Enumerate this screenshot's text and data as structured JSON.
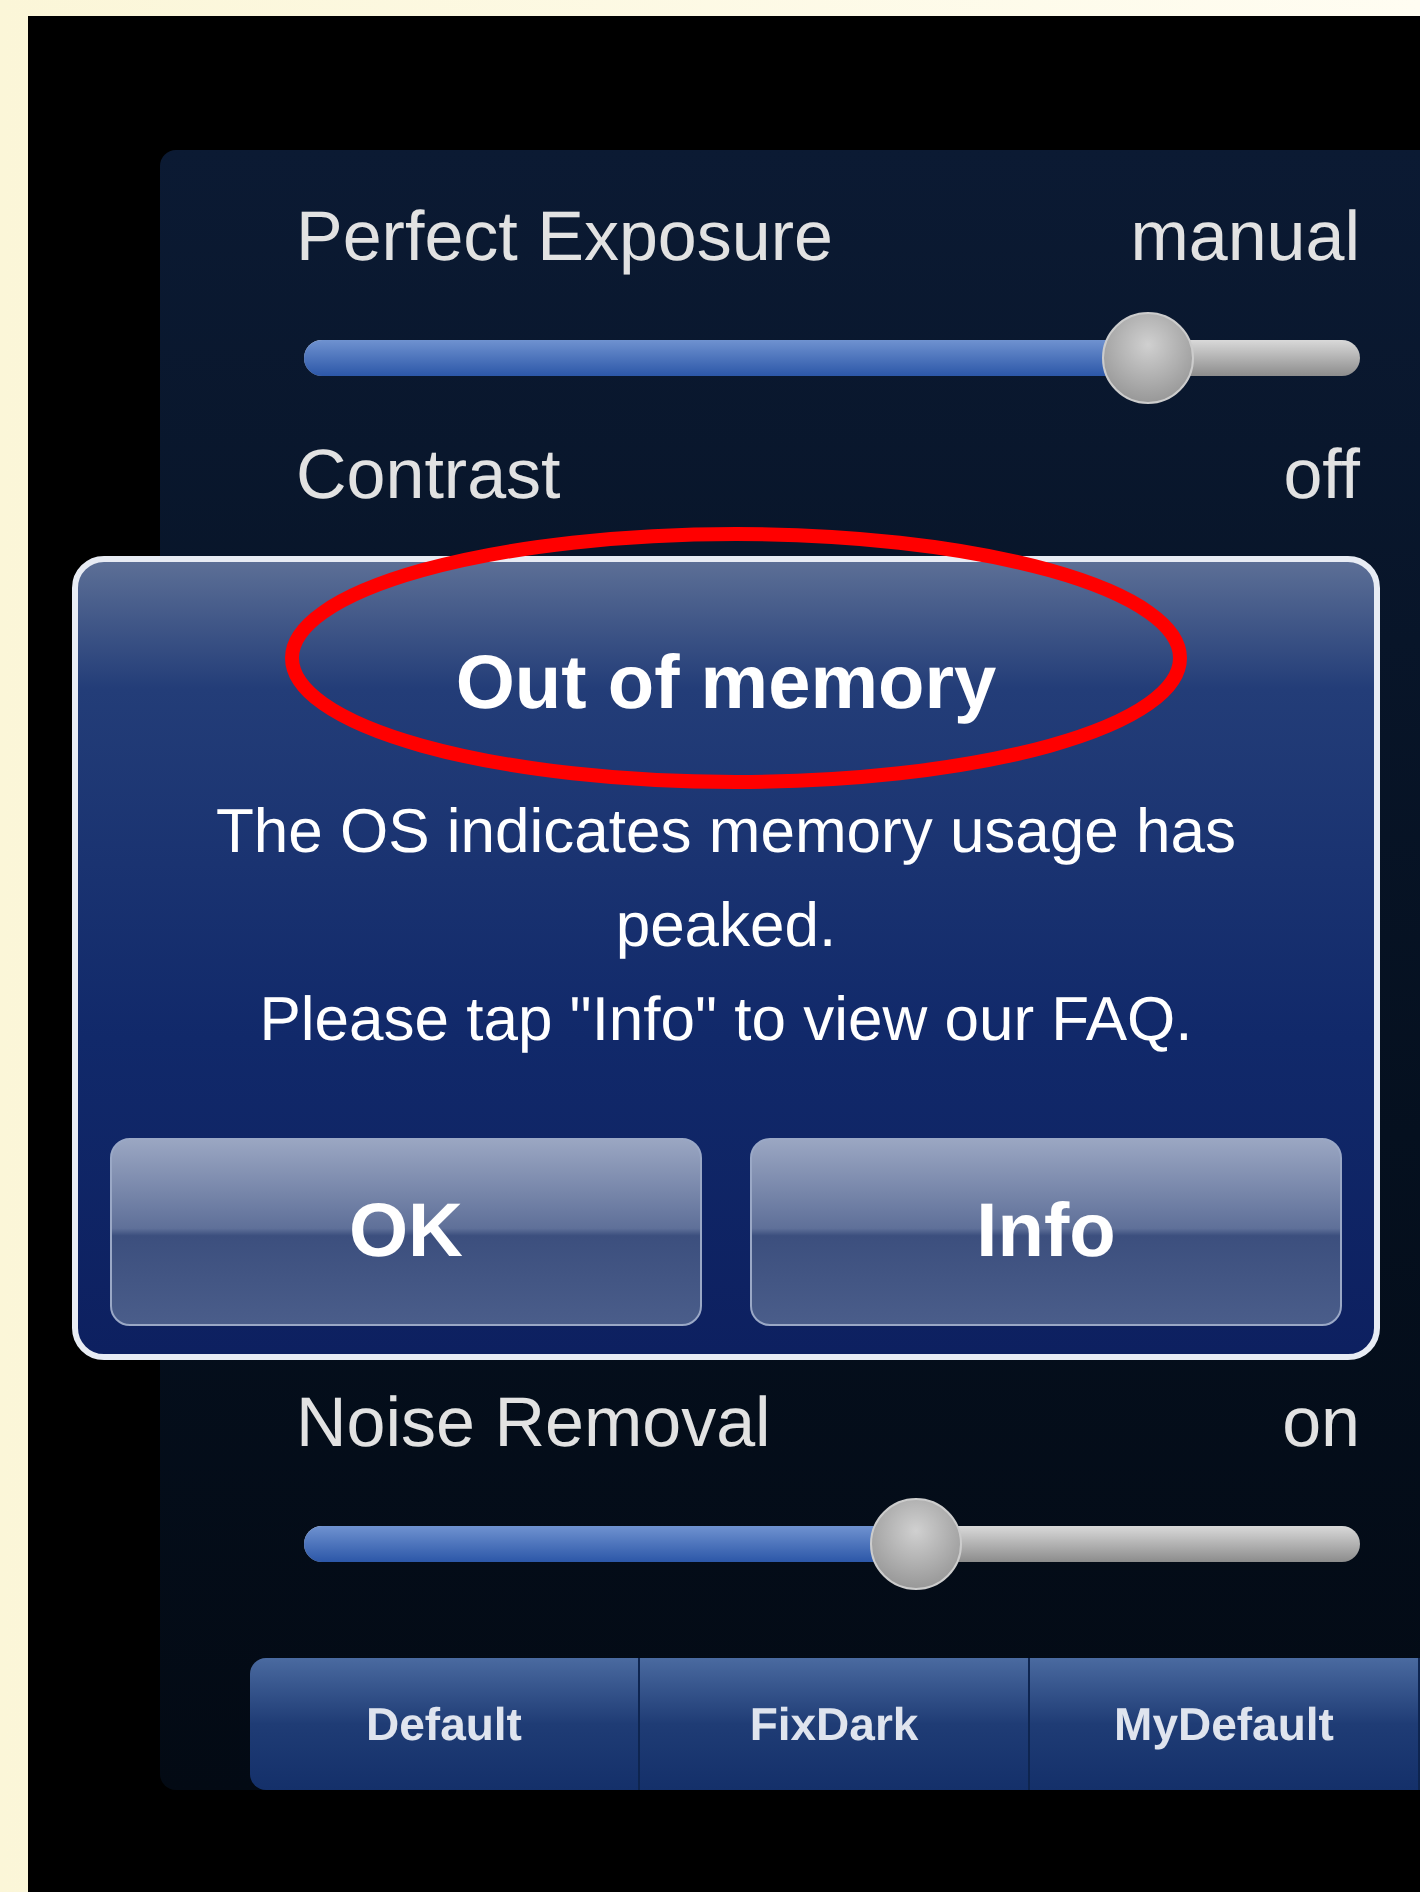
{
  "settings_top": [
    {
      "label": "Perfect Exposure",
      "value": "manual",
      "level": 0.8
    },
    {
      "label": "Contrast",
      "value": "off"
    }
  ],
  "settings_bottom": [
    {
      "label": "Noise Removal",
      "value": "on",
      "level": 0.58
    }
  ],
  "presets": [
    "Default",
    "FixDark",
    "MyDefault"
  ],
  "alert": {
    "title": "Out of memory",
    "message": [
      "The OS indicates memory usage has peaked.",
      "Please tap \"Info\" to view our FAQ."
    ],
    "buttons": [
      "OK",
      "Info"
    ]
  }
}
